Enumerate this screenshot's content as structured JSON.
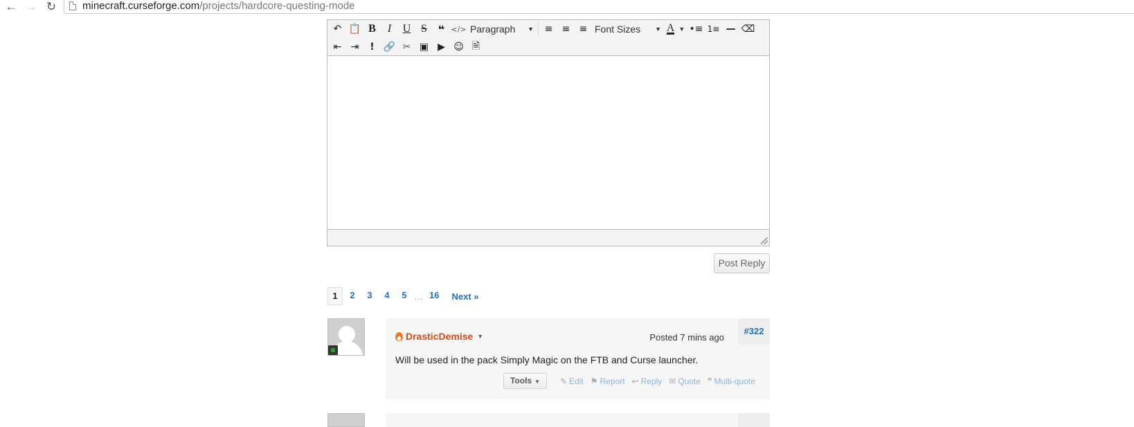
{
  "browser": {
    "url_host": "minecraft.curseforge.com",
    "url_path": "/projects/hardcore-questing-mode"
  },
  "editor": {
    "toolbar_row1": [
      "undo-icon",
      "paste-icon",
      "bold-icon",
      "italic-icon",
      "underline-icon",
      "strikethrough-icon",
      "quote-icon",
      "code-icon",
      "paragraph-select",
      "align-left-icon",
      "align-center-icon",
      "align-right-icon",
      "font-sizes-select",
      "text-color-icon",
      "bullet-list-icon",
      "numbered-list-icon",
      "horizontal-rule-icon",
      "eraser-icon"
    ],
    "toolbar_row2": [
      "outdent-icon",
      "indent-icon",
      "spoiler-icon",
      "link-icon",
      "unlink-icon",
      "image-icon",
      "video-icon",
      "emoji-icon",
      "source-icon"
    ],
    "paragraph_label": "Paragraph",
    "font_sizes_label": "Font Sizes",
    "glyphs": {
      "bold": "B",
      "italic": "I",
      "underline": "U",
      "strike": "S",
      "color": "A",
      "spoiler": "!"
    }
  },
  "post_reply_label": "Post Reply",
  "pagination": {
    "pages": [
      "1",
      "2",
      "3",
      "4",
      "5"
    ],
    "ellipsis": "…",
    "last": "16",
    "next": "Next »",
    "current": "1"
  },
  "post": {
    "number": "#322",
    "author": "DrasticDemise",
    "posted": "Posted 7 mins ago",
    "body": "Will be used in the pack Simply Magic on the FTB and Curse launcher.",
    "tools_label": "Tools",
    "actions": {
      "edit": "Edit",
      "report": "Report",
      "reply": "Reply",
      "quote": "Quote",
      "multiquote": "Multi-quote"
    }
  },
  "colors": {
    "link": "#2a6fb8",
    "author": "#c8501e",
    "online": "#2e9d2e",
    "action_link": "#8fb2d6"
  }
}
